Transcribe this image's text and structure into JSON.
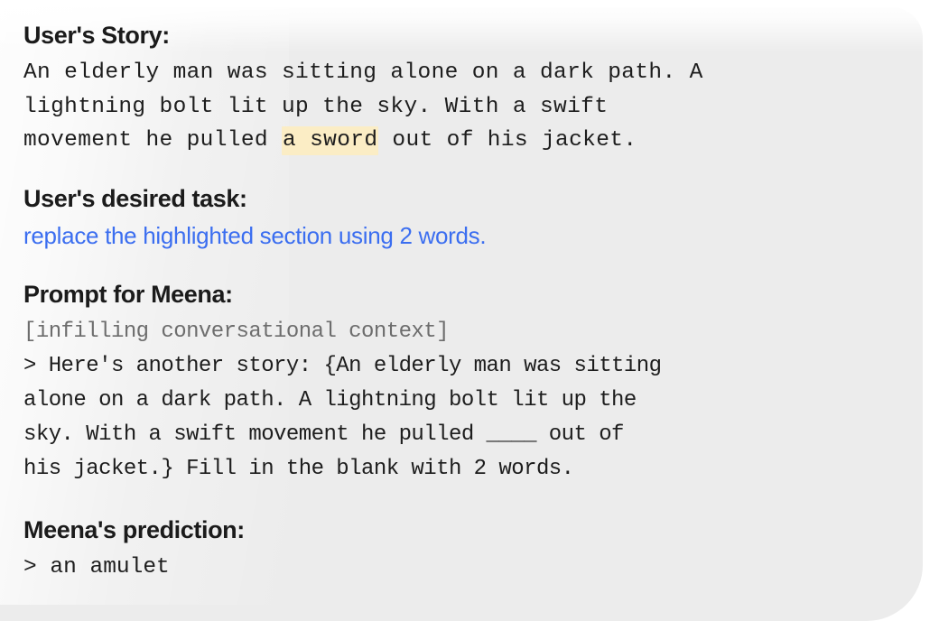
{
  "card": {
    "background_color": "#ececec",
    "page_background_color": "#ffffff"
  },
  "colors": {
    "heading": "#1b1b1b",
    "body": "#1d1d1d",
    "muted": "#6d6d6d",
    "task_blue": "#3b6ef0",
    "highlight": "#fbedc5"
  },
  "story": {
    "heading": "User's Story:",
    "lines": [
      {
        "text": "An elderly man was sitting alone on a dark path. A"
      },
      {
        "text": "lightning bolt lit up the sky. With a swift"
      }
    ],
    "last_line": {
      "before": "movement he pulled ",
      "highlighted": "a sword",
      "after": " out of his jacket."
    }
  },
  "task": {
    "heading": "User's desired task:",
    "text": "replace the highlighted section using 2 words."
  },
  "prompt": {
    "heading": "Prompt for Meena:",
    "context_note": "[infilling conversational context]",
    "lines": [
      "> Here's another story: {An elderly man was sitting",
      "alone on a dark path. A lightning bolt lit up the",
      "sky. With a swift movement he pulled ____ out of",
      "his jacket.} Fill in the blank with 2 words."
    ]
  },
  "prediction": {
    "heading": "Meena's prediction:",
    "text": "> an amulet"
  }
}
